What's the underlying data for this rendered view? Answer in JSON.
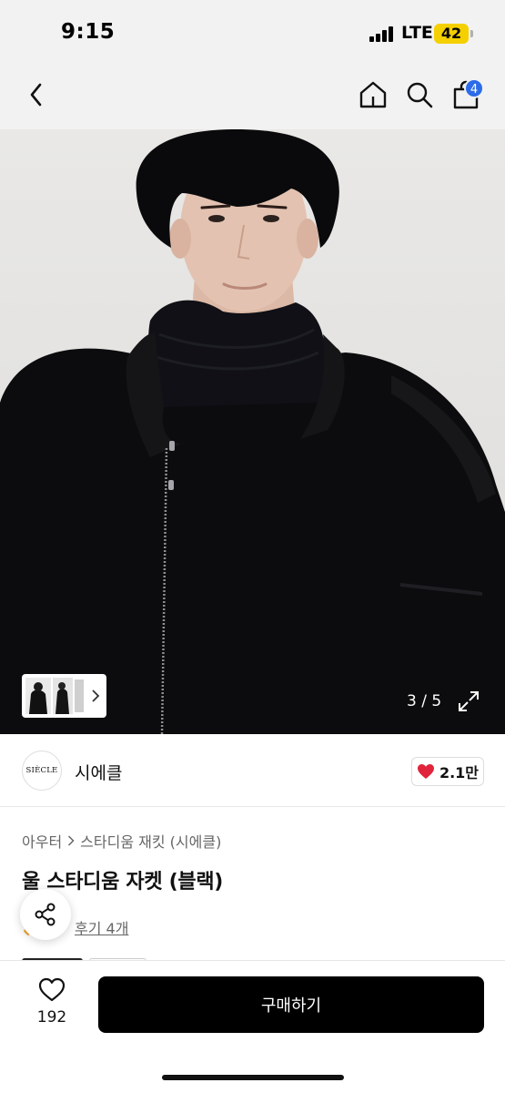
{
  "status_bar": {
    "time": "9:15",
    "network": "LTE",
    "battery": "42"
  },
  "nav": {
    "back_icon": "chevron-left-icon",
    "home_icon": "home-icon",
    "search_icon": "search-icon",
    "cart_icon": "shopping-bag-icon",
    "cart_count": "4",
    "badge_color": "#2c6ce8"
  },
  "gallery": {
    "counter": "3 / 5",
    "expand_icon": "expand-icon",
    "thumbnail_arrow_icon": "chevron-right-icon",
    "current_index": 3,
    "total": 5
  },
  "brand": {
    "logo_text": "SIÈCLE",
    "name": "시에클",
    "like_count": "2.1만",
    "heart_color": "#e0243b"
  },
  "product": {
    "breadcrumb": [
      "아우터",
      "스타디움 재킷 (시에클)"
    ],
    "title": "울 스타디움 자켓 (블랙)",
    "review_link": "후기 4개"
  },
  "bottom_bar": {
    "wish_count": "192",
    "buy_label": "구매하기"
  }
}
